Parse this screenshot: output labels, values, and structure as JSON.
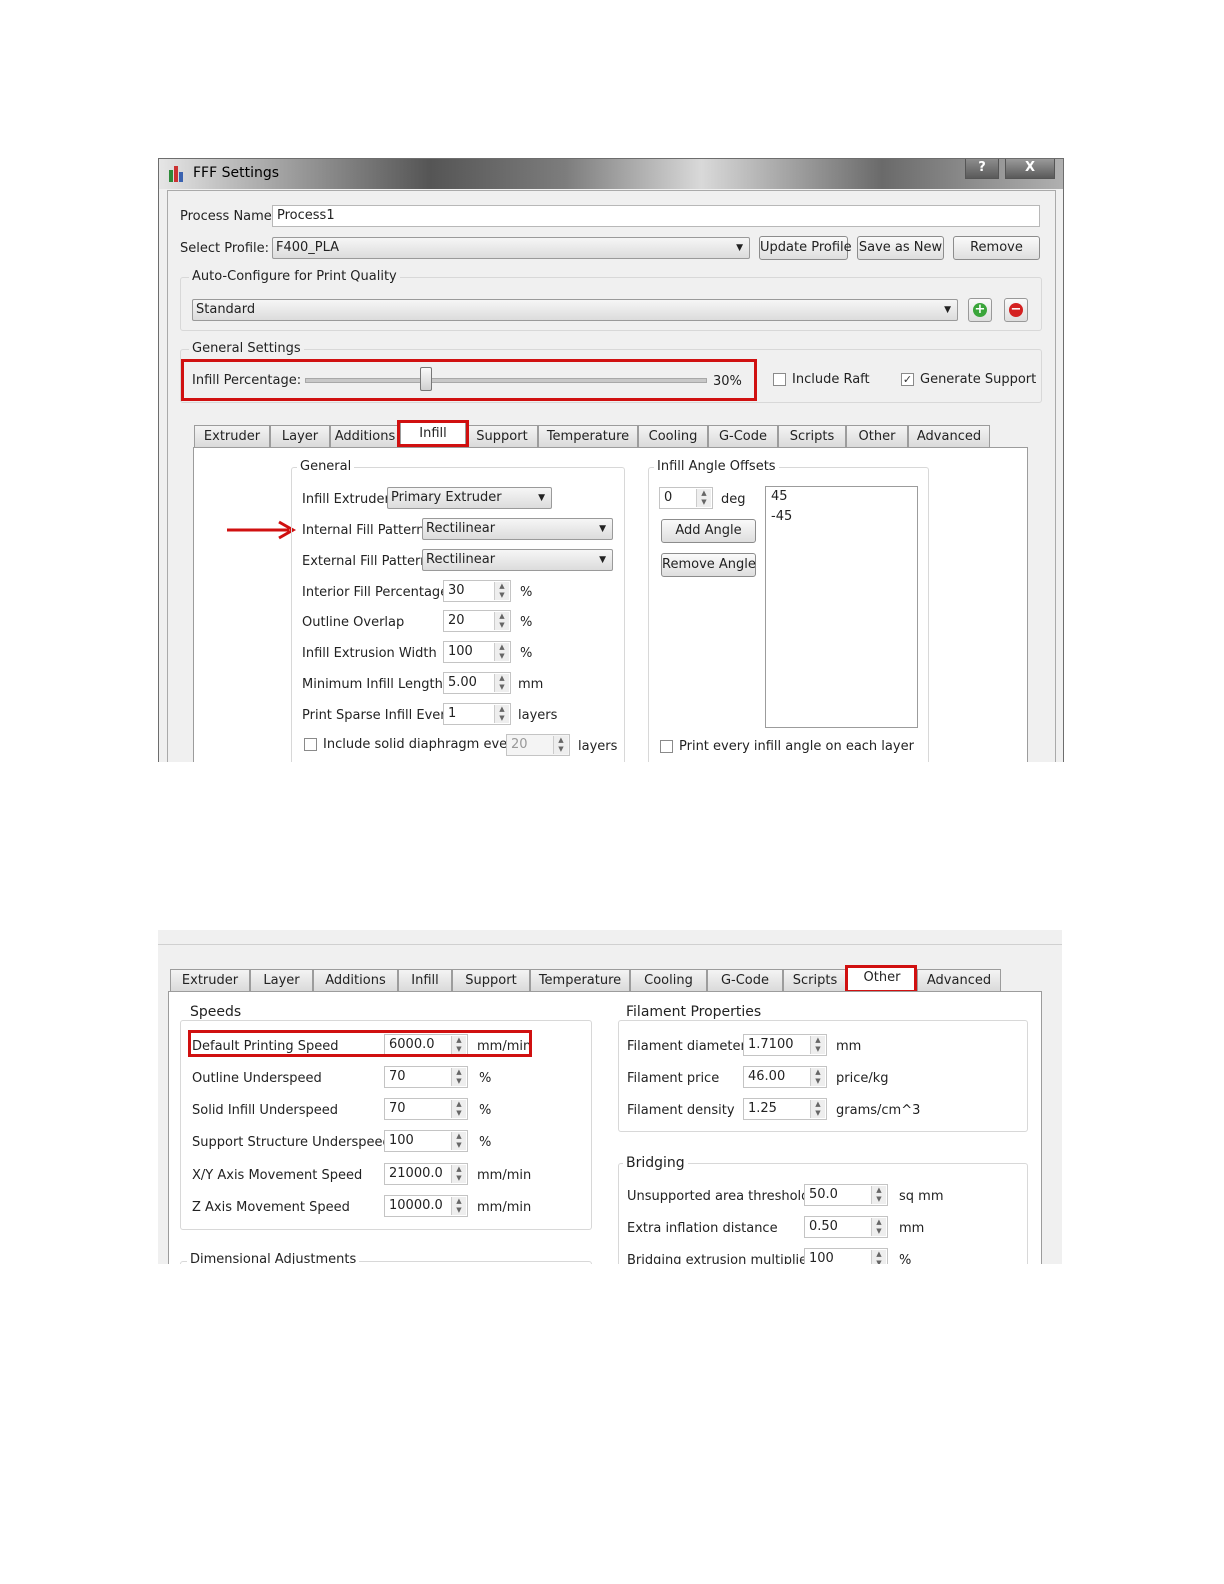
{
  "window": {
    "title": "FFF Settings",
    "help_button": "?",
    "close_button": "X"
  },
  "process": {
    "name_label": "Process Name:",
    "name_value": "Process1",
    "profile_label": "Select Profile:",
    "profile_value": "F400_PLA",
    "update_profile": "Update Profile",
    "save_as_new": "Save as New",
    "remove": "Remove"
  },
  "auto_configure": {
    "title": "Auto-Configure for Print Quality",
    "value": "Standard",
    "add_icon": "plus-icon",
    "remove_icon": "minus-icon"
  },
  "general_settings": {
    "title": "General Settings",
    "infill_label": "Infill Percentage:",
    "infill_value": "30%",
    "infill_fraction": 0.3,
    "include_raft": "Include Raft",
    "include_raft_checked": false,
    "generate_support": "Generate Support",
    "generate_support_checked": true
  },
  "tabs": [
    "Extruder",
    "Layer",
    "Additions",
    "Infill",
    "Support",
    "Temperature",
    "Cooling",
    "G-Code",
    "Scripts",
    "Other",
    "Advanced"
  ],
  "infill_tab": {
    "general_title": "General",
    "infill_extruder_label": "Infill Extruder",
    "infill_extruder_value": "Primary Extruder",
    "internal_pattern_label": "Internal Fill Pattern",
    "internal_pattern_value": "Rectilinear",
    "external_pattern_label": "External Fill Pattern",
    "external_pattern_value": "Rectilinear",
    "rows": [
      {
        "label": "Interior Fill Percentage",
        "value": "30",
        "unit": "%"
      },
      {
        "label": "Outline Overlap",
        "value": "20",
        "unit": "%"
      },
      {
        "label": "Infill Extrusion Width",
        "value": "100",
        "unit": "%"
      },
      {
        "label": "Minimum Infill Length",
        "value": "5.00",
        "unit": "mm"
      },
      {
        "label": "Print Sparse Infill Every",
        "value": "1",
        "unit": "layers"
      }
    ],
    "diaphragm_label": "Include solid diaphragm every",
    "diaphragm_value": "20",
    "diaphragm_unit": "layers",
    "angle_title": "Infill Angle Offsets",
    "angle_value": "0",
    "angle_unit": "deg",
    "add_angle": "Add Angle",
    "remove_angle": "Remove Angle",
    "angles": [
      "45",
      "-45"
    ],
    "print_every_angle": "Print every infill angle on each layer"
  },
  "other_tab": {
    "speeds_title": "Speeds",
    "speeds": [
      {
        "label": "Default Printing Speed",
        "value": "6000.0",
        "unit": "mm/min"
      },
      {
        "label": "Outline Underspeed",
        "value": "70",
        "unit": "%"
      },
      {
        "label": "Solid Infill Underspeed",
        "value": "70",
        "unit": "%"
      },
      {
        "label": "Support Structure Underspeed",
        "value": "100",
        "unit": "%"
      },
      {
        "label": "X/Y Axis Movement Speed",
        "value": "21000.0",
        "unit": "mm/min"
      },
      {
        "label": "Z Axis Movement Speed",
        "value": "10000.0",
        "unit": "mm/min"
      }
    ],
    "dimensional_title": "Dimensional Adjustments",
    "filament_title": "Filament Properties",
    "filament": [
      {
        "label": "Filament diameter",
        "value": "1.7100",
        "unit": "mm"
      },
      {
        "label": "Filament price",
        "value": "46.00",
        "unit": "price/kg"
      },
      {
        "label": "Filament density",
        "value": "1.25",
        "unit": "grams/cm^3"
      }
    ],
    "bridging_title": "Bridging",
    "bridging": [
      {
        "label": "Unsupported area threshold",
        "value": "50.0",
        "unit": "sq mm"
      },
      {
        "label": "Extra inflation distance",
        "value": "0.50",
        "unit": "mm"
      },
      {
        "label": "Bridging extrusion multiplier",
        "value": "100",
        "unit": "%"
      }
    ]
  },
  "colors": {
    "highlight": "#d01010",
    "add_green": "#3aa53a",
    "remove_red": "#d42020"
  }
}
